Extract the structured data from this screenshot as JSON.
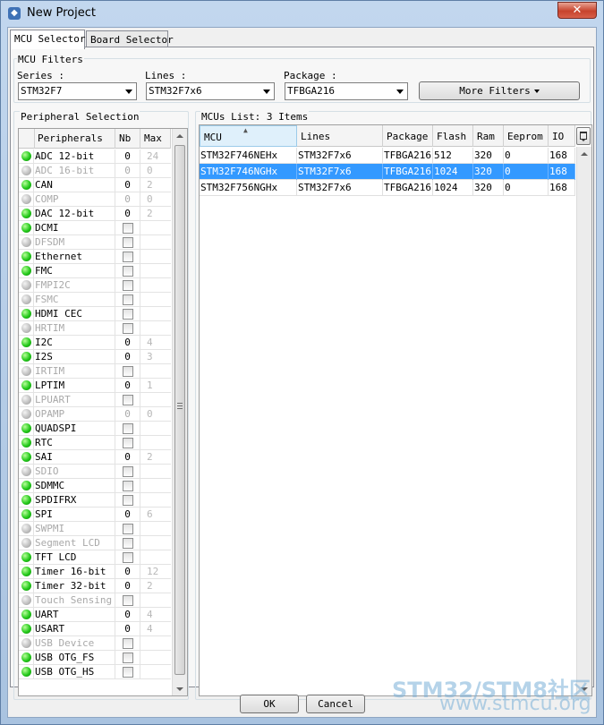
{
  "window": {
    "title": "New Project",
    "close_glyph": "✕"
  },
  "tabs": [
    {
      "label": "MCU Selector",
      "active": true
    },
    {
      "label": "Board Selector",
      "active": false
    }
  ],
  "filters": {
    "group_label": "MCU Filters",
    "series": {
      "label": "Series :",
      "value": "STM32F7"
    },
    "lines": {
      "label": "Lines :",
      "value": "STM32F7x6"
    },
    "package": {
      "label": "Package :",
      "value": "TFBGA216"
    },
    "more_filters_label": "More Filters"
  },
  "peripherals": {
    "section_label": "Peripheral Selection",
    "columns": [
      "Peripherals",
      "Nb",
      "Max"
    ],
    "rows": [
      {
        "name": "ADC 12-bit",
        "on": true,
        "nb": "0",
        "max": "24"
      },
      {
        "name": "ADC 16-bit",
        "on": false,
        "nb": "0",
        "max": "0"
      },
      {
        "name": "CAN",
        "on": true,
        "nb": "0",
        "max": "2"
      },
      {
        "name": "COMP",
        "on": false,
        "nb": "0",
        "max": "0"
      },
      {
        "name": "DAC 12-bit",
        "on": true,
        "nb": "0",
        "max": "2"
      },
      {
        "name": "DCMI",
        "on": true,
        "checkbox": true
      },
      {
        "name": "DFSDM",
        "on": false,
        "checkbox": true
      },
      {
        "name": "Ethernet",
        "on": true,
        "checkbox": true
      },
      {
        "name": "FMC",
        "on": true,
        "checkbox": true
      },
      {
        "name": "FMPI2C",
        "on": false,
        "checkbox": true
      },
      {
        "name": "FSMC",
        "on": false,
        "checkbox": true
      },
      {
        "name": "HDMI CEC",
        "on": true,
        "checkbox": true
      },
      {
        "name": "HRTIM",
        "on": false,
        "checkbox": true
      },
      {
        "name": "I2C",
        "on": true,
        "nb": "0",
        "max": "4"
      },
      {
        "name": "I2S",
        "on": true,
        "nb": "0",
        "max": "3"
      },
      {
        "name": "IRTIM",
        "on": false,
        "checkbox": true
      },
      {
        "name": "LPTIM",
        "on": true,
        "nb": "0",
        "max": "1"
      },
      {
        "name": "LPUART",
        "on": false,
        "checkbox": true
      },
      {
        "name": "OPAMP",
        "on": false,
        "nb": "0",
        "max": "0"
      },
      {
        "name": "QUADSPI",
        "on": true,
        "checkbox": true
      },
      {
        "name": "RTC",
        "on": true,
        "checkbox": true
      },
      {
        "name": "SAI",
        "on": true,
        "nb": "0",
        "max": "2"
      },
      {
        "name": "SDIO",
        "on": false,
        "checkbox": true
      },
      {
        "name": "SDMMC",
        "on": true,
        "checkbox": true
      },
      {
        "name": "SPDIFRX",
        "on": true,
        "checkbox": true
      },
      {
        "name": "SPI",
        "on": true,
        "nb": "0",
        "max": "6"
      },
      {
        "name": "SWPMI",
        "on": false,
        "checkbox": true
      },
      {
        "name": "Segment LCD",
        "on": false,
        "checkbox": true
      },
      {
        "name": "TFT LCD",
        "on": true,
        "checkbox": true
      },
      {
        "name": "Timer 16-bit",
        "on": true,
        "nb": "0",
        "max": "12"
      },
      {
        "name": "Timer 32-bit",
        "on": true,
        "nb": "0",
        "max": "2"
      },
      {
        "name": "Touch Sensing",
        "on": false,
        "checkbox": true
      },
      {
        "name": "UART",
        "on": true,
        "nb": "0",
        "max": "4"
      },
      {
        "name": "USART",
        "on": true,
        "nb": "0",
        "max": "4"
      },
      {
        "name": "USB Device",
        "on": false,
        "checkbox": true
      },
      {
        "name": "USB OTG_FS",
        "on": true,
        "checkbox": true
      },
      {
        "name": "USB OTG_HS",
        "on": true,
        "checkbox": true
      }
    ]
  },
  "mcus": {
    "section_label": "MCUs List: 3 Items",
    "columns": [
      "MCU",
      "Lines",
      "Package",
      "Flash",
      "Ram",
      "Eeprom",
      "IO"
    ],
    "rows": [
      [
        "STM32F746NEHx",
        "STM32F7x6",
        "TFBGA216",
        "512",
        "320",
        "0",
        "168"
      ],
      [
        "STM32F746NGHx",
        "STM32F7x6",
        "TFBGA216",
        "1024",
        "320",
        "0",
        "168"
      ],
      [
        "STM32F756NGHx",
        "STM32F7x6",
        "TFBGA216",
        "1024",
        "320",
        "0",
        "168"
      ]
    ],
    "selected_index": 1
  },
  "footer": {
    "ok_label": "OK",
    "cancel_label": "Cancel"
  },
  "watermark": {
    "line1": "STM32/STM8社区",
    "line2": "www.stmcu.org"
  },
  "colors": {
    "selection": "#3399ff",
    "enabled_dot": "#23c91a",
    "disabled_dot": "#bcbcbc"
  }
}
